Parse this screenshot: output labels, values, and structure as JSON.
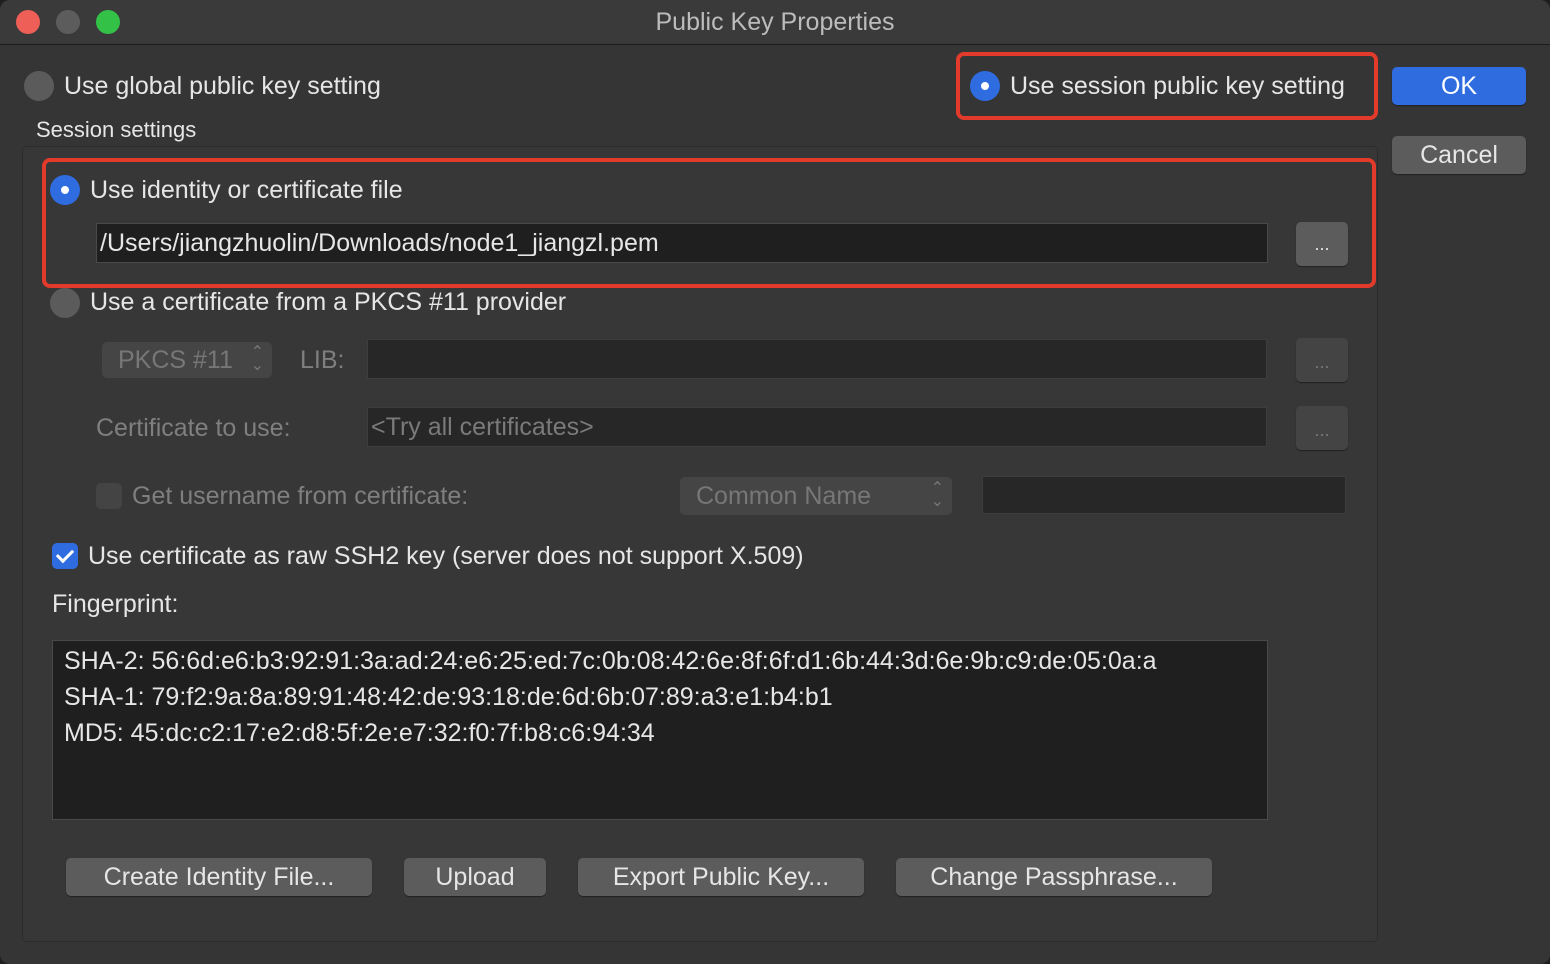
{
  "window": {
    "title": "Public Key Properties"
  },
  "top": {
    "global_label": "Use global public key setting",
    "session_label": "Use session public key setting",
    "ok_label": "OK",
    "cancel_label": "Cancel"
  },
  "session": {
    "group_label": "Session settings",
    "identity_label": "Use identity or certificate file",
    "identity_path": "/Users/jiangzhuolin/Downloads/node1_jiangzl.pem",
    "browse_label": "...",
    "pkcs_label": "Use a certificate from a PKCS #11 provider",
    "pkcs_popup": "PKCS #11",
    "lib_label": "LIB:",
    "lib_value": "",
    "cert_label": "Certificate to use:",
    "cert_placeholder": "<Try all certificates>",
    "username_label": "Get username from certificate:",
    "username_popup": "Common Name",
    "raw_ssh2_label": "Use certificate as raw SSH2 key (server does not support X.509)",
    "fingerprint_label": "Fingerprint:",
    "fingerprints": [
      "SHA-2: 56:6d:e6:b3:92:91:3a:ad:24:e6:25:ed:7c:0b:08:42:6e:8f:6f:d1:6b:44:3d:6e:9b:c9:de:05:0a:a",
      "SHA-1: 79:f2:9a:8a:89:91:48:42:de:93:18:de:6d:6b:07:89:a3:e1:b4:b1",
      "MD5: 45:dc:c2:17:e2:d8:5f:2e:e7:32:f0:7f:b8:c6:94:34"
    ]
  },
  "buttons": {
    "create_identity": "Create Identity File...",
    "upload": "Upload",
    "export_public_key": "Export Public Key...",
    "change_passphrase": "Change Passphrase..."
  },
  "colors": {
    "accent": "#2f6ce0",
    "highlight": "#e23a2b",
    "window_bg": "#353535"
  }
}
